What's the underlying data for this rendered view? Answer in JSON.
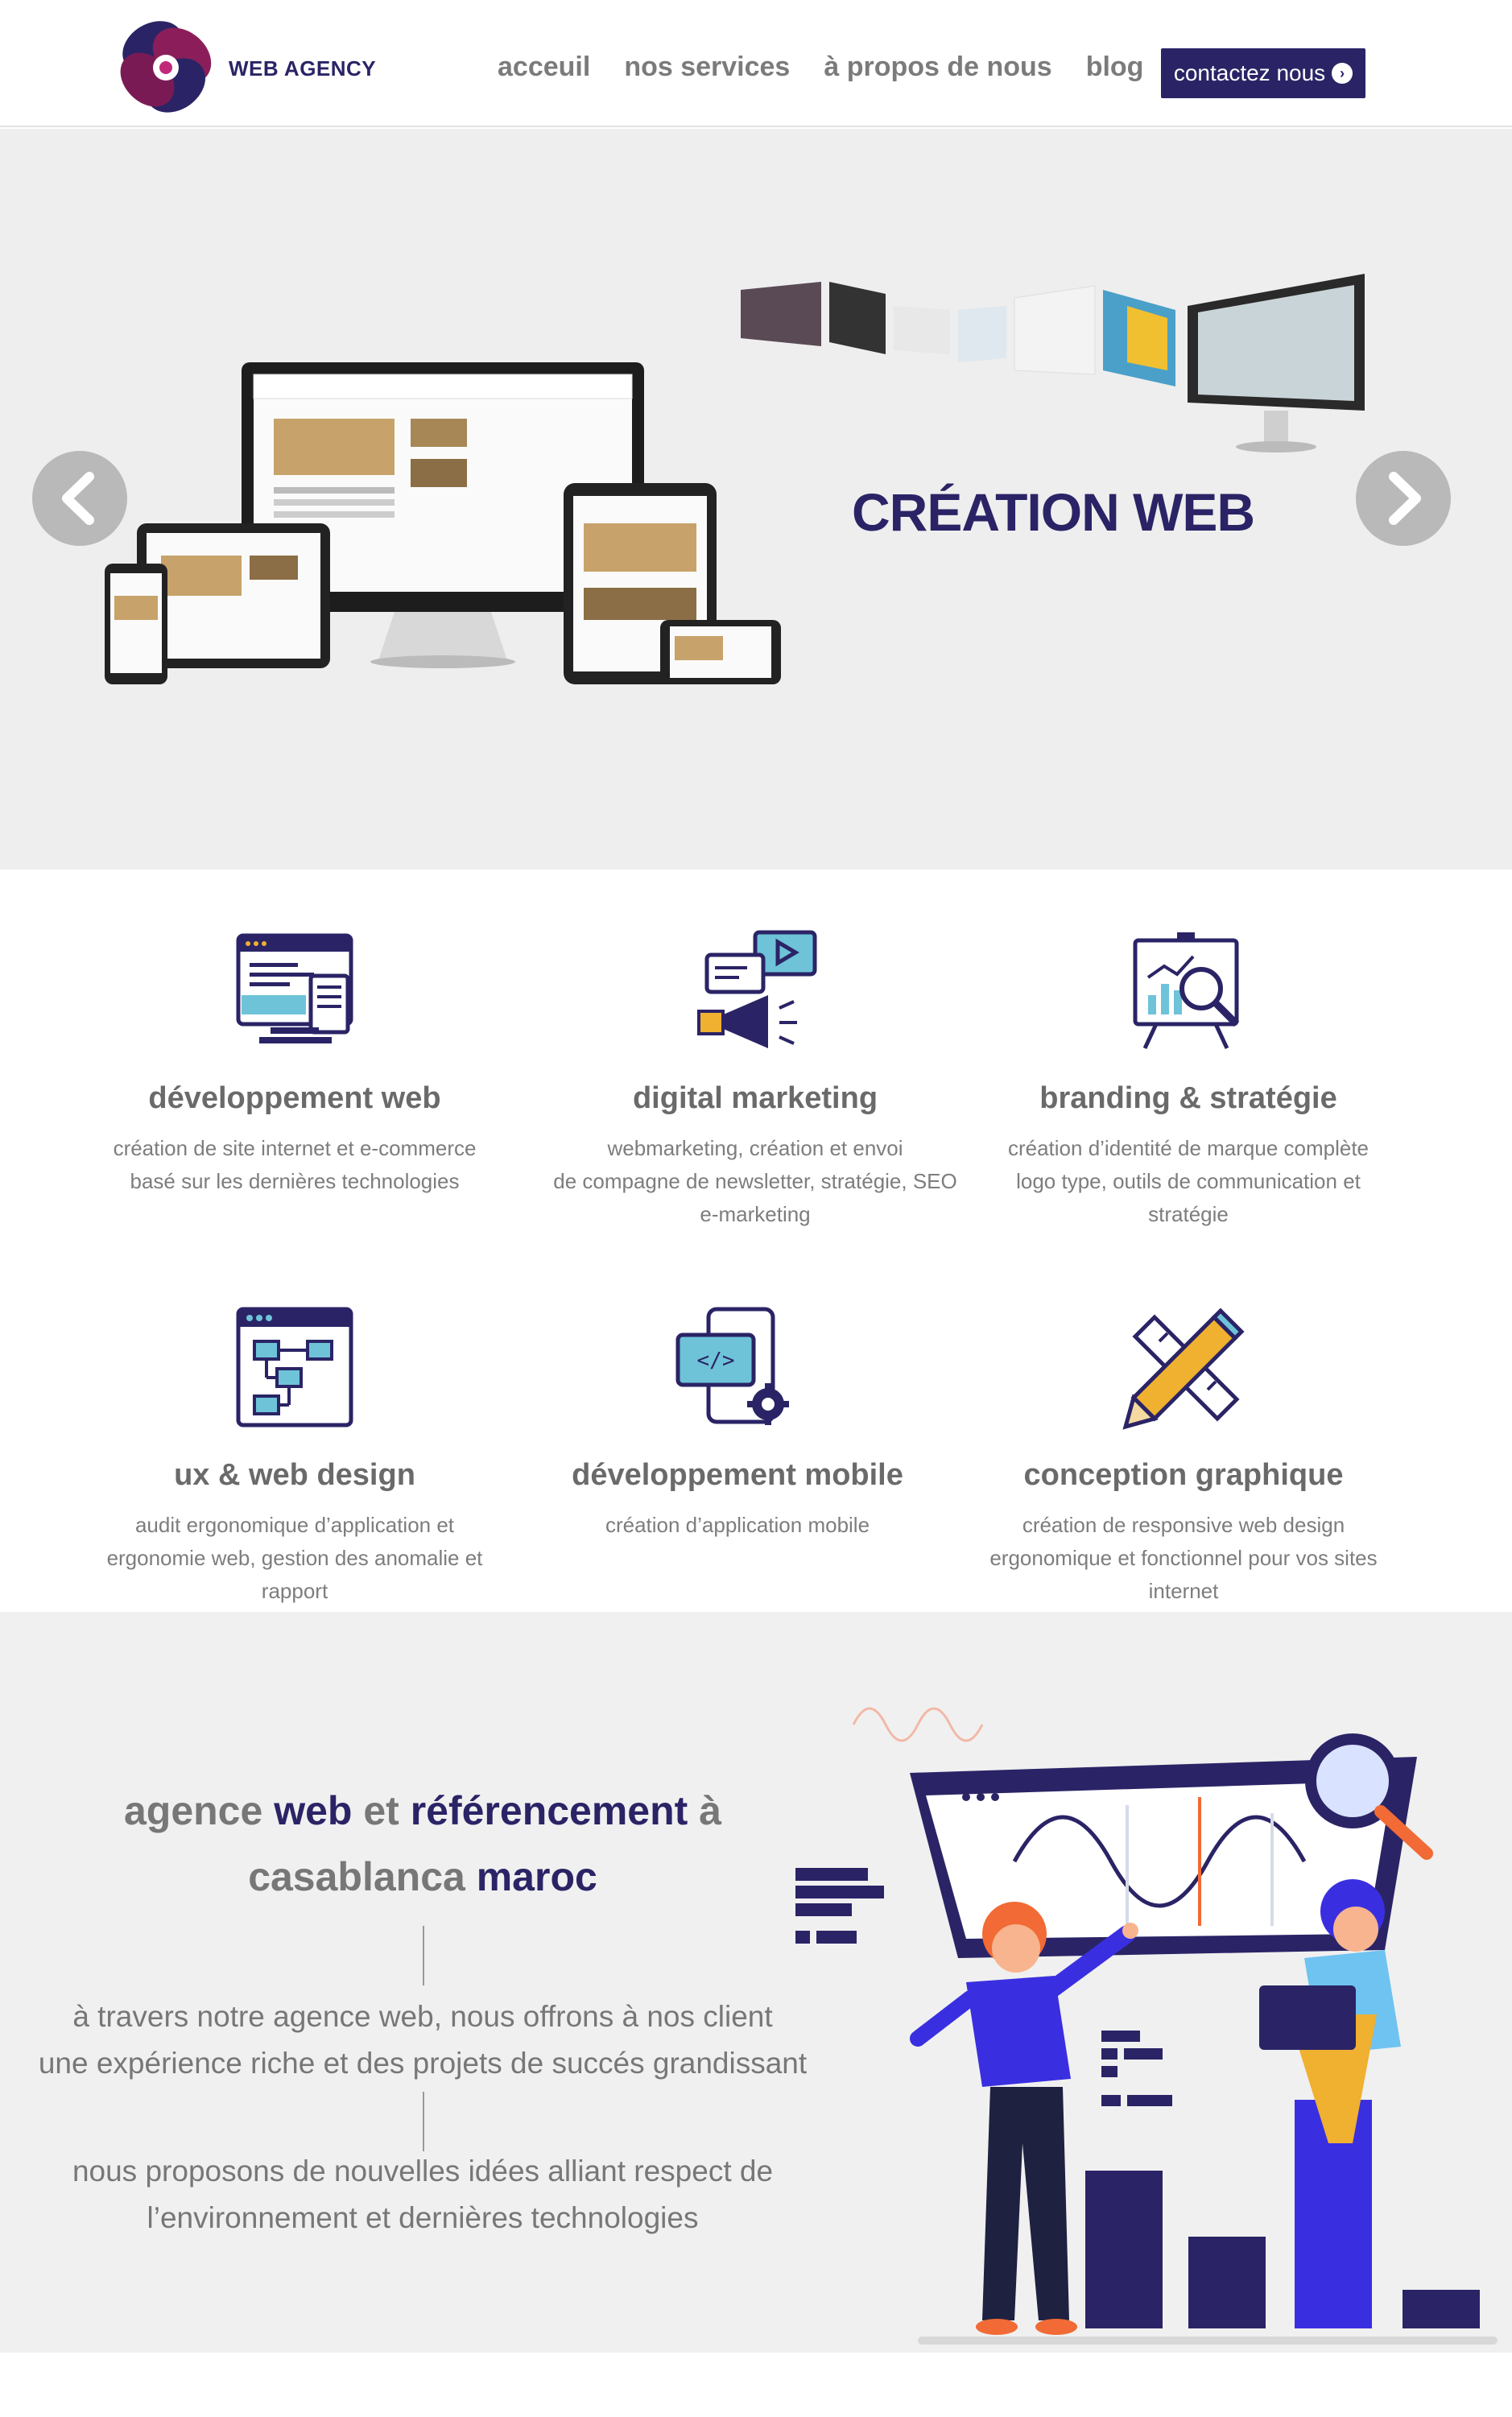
{
  "header": {
    "brand": "WEB AGENCY",
    "nav": [
      "acceuil",
      "nos services",
      "à propos de nous",
      "blog"
    ],
    "cta_label": "contactez nous",
    "cta_icon": "chevron-right-circle-icon"
  },
  "slider": {
    "title": "CRÉATION WEB",
    "prev_icon": "chevron-left-icon",
    "next_icon": "chevron-right-icon"
  },
  "services": [
    {
      "icon": "monitor-code-icon",
      "title": "développement web",
      "desc": "création de site internet et e-commerce\nbasé sur les dernières  technologies"
    },
    {
      "icon": "megaphone-video-icon",
      "title": "digital marketing",
      "desc": "webmarketing, création et envoi\nde compagne de newsletter, stratégie, SEO\ne-marketing"
    },
    {
      "icon": "chart-magnifier-icon",
      "title": "branding & stratégie",
      "desc": "création d’identité de marque complète\nlogo type, outils de communication et\nstratégie"
    },
    {
      "icon": "flowchart-window-icon",
      "title": "ux & web design",
      "desc": "audit ergonomique d’application et\nergonomie web, gestion des anomalie et\nrapport"
    },
    {
      "icon": "mobile-code-gear-icon",
      "title": "développement mobile",
      "desc": "création d’application mobile"
    },
    {
      "icon": "pencil-ruler-icon",
      "title": "conception graphique",
      "desc": "création de responsive web design\nergonomique et fonctionnel pour vos sites\ninternet"
    }
  ],
  "about": {
    "title_parts": [
      "agence ",
      "web",
      " et ",
      "référencement",
      " à",
      "casablanca ",
      "maroc"
    ],
    "para1": "à travers notre agence web, nous offrons à nos client\nune expérience riche et des projets de succés grandissant",
    "para2": "nous proposons de nouvelles idées alliant respect de\nl’environnement et dernières technologies"
  },
  "colors": {
    "brand": "#2a2466",
    "accent": "#3a2fe0",
    "orange": "#f26a35"
  }
}
